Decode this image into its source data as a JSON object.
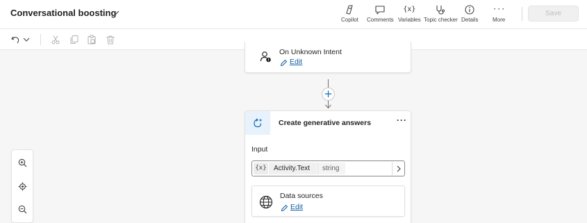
{
  "header": {
    "title": "Conversational boosting",
    "tools": [
      {
        "label": "Copilot",
        "icon": "copilot-icon"
      },
      {
        "label": "Comments",
        "icon": "comment-icon"
      },
      {
        "label": "Variables",
        "icon": "variables-icon",
        "glyph": "{x}"
      },
      {
        "label": "Topic checker",
        "icon": "stethoscope-icon"
      },
      {
        "label": "Details",
        "icon": "info-icon"
      },
      {
        "label": "More",
        "icon": "more-icon",
        "glyph": "···"
      }
    ],
    "save_label": "Save"
  },
  "toolbar": {
    "icons": [
      "undo-icon",
      "chevron-down-icon",
      "cut-icon",
      "copy-icon",
      "paste-icon",
      "delete-icon"
    ]
  },
  "nodes": {
    "unknown_intent": {
      "label": "On Unknown Intent",
      "edit_label": "Edit",
      "icon": "person-alert-icon"
    },
    "add_node": {
      "glyph": "+"
    },
    "generative_answers": {
      "title": "Create generative answers",
      "menu_glyph": "···",
      "input_label": "Input",
      "input": {
        "var_glyph": "{x}",
        "name": "Activity.Text",
        "type": "string"
      },
      "data_sources": {
        "label": "Data sources",
        "edit_label": "Edit",
        "icon": "globe-icon"
      }
    }
  },
  "zoom_controls": {
    "icons": [
      "zoom-in-icon",
      "recenter-icon",
      "zoom-out-icon"
    ]
  },
  "colors": {
    "accent": "#0f6cbd",
    "link": "#115ea3",
    "icon_tint": "#e8f2fc"
  }
}
